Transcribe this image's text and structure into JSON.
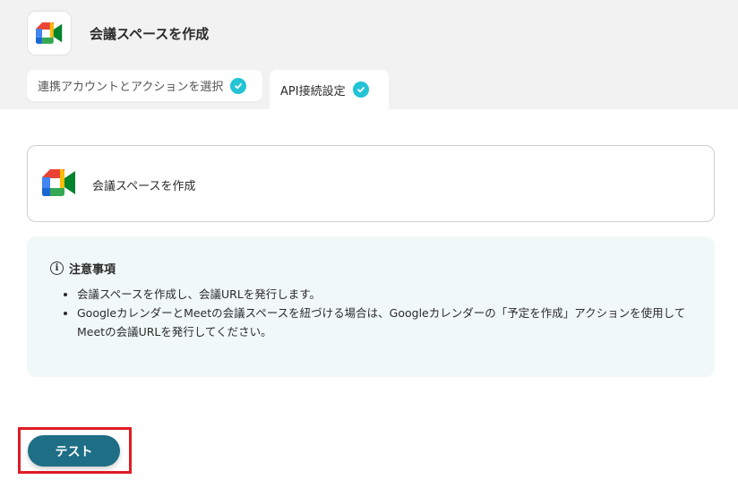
{
  "header": {
    "title": "会議スペースを作成",
    "app_icon": "google-meet-icon"
  },
  "tabs": [
    {
      "label": "連携アカウントとアクションを選択",
      "completed": true
    },
    {
      "label": "API接続設定",
      "completed": true,
      "active": true
    }
  ],
  "action_card": {
    "label": "会議スペースを作成",
    "icon": "google-meet-icon"
  },
  "notice": {
    "title": "注意事項",
    "items": [
      "会議スペースを作成し、会議URLを発行します。",
      "GoogleカレンダーとMeetの会議スペースを紐づける場合は、Googleカレンダーの「予定を作成」アクションを使用してMeetの会議URLを発行してください。"
    ]
  },
  "test_button": {
    "label": "テスト"
  },
  "colors": {
    "check": "#24c3d6",
    "button": "#1e6e85",
    "notice_bg": "#f1f9f8",
    "highlight": "#e01b24"
  }
}
